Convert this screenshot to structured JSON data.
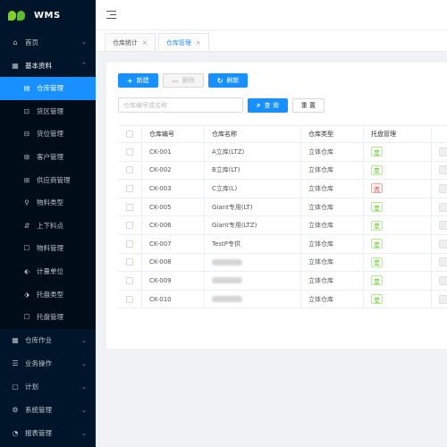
{
  "app": {
    "title": "WMS"
  },
  "sidebar": {
    "items": [
      {
        "label": "首页",
        "icon": "home-icon",
        "glyph": "⌂",
        "expanded": false
      },
      {
        "label": "基本资料",
        "icon": "grid-icon",
        "glyph": "▦",
        "expanded": true,
        "children": [
          {
            "label": "仓库管理",
            "icon": "document-icon",
            "glyph": "▤",
            "active": true
          },
          {
            "label": "货区管理",
            "icon": "area-icon",
            "glyph": "⊡"
          },
          {
            "label": "货位管理",
            "icon": "location-icon",
            "glyph": "⊟"
          },
          {
            "label": "客户管理",
            "icon": "customer-icon",
            "glyph": "⊞"
          },
          {
            "label": "供应商管理",
            "icon": "supplier-icon",
            "glyph": "⊞"
          },
          {
            "label": "物料类型",
            "icon": "material-type-icon",
            "glyph": "⚲"
          },
          {
            "label": "上下料点",
            "icon": "load-point-icon",
            "glyph": "⇵"
          },
          {
            "label": "物料管理",
            "icon": "material-icon",
            "glyph": "☐"
          },
          {
            "label": "计量单位",
            "icon": "unit-icon",
            "glyph": "⬖"
          },
          {
            "label": "托盘类型",
            "icon": "pallet-type-icon",
            "glyph": "⬗"
          },
          {
            "label": "托盘管理",
            "icon": "pallet-icon",
            "glyph": "☐"
          }
        ]
      },
      {
        "label": "仓库作业",
        "icon": "warehouse-ops-icon",
        "glyph": "▦",
        "expanded": false
      },
      {
        "label": "业务操作",
        "icon": "business-icon",
        "glyph": "☰",
        "expanded": false
      },
      {
        "label": "计划",
        "icon": "plan-icon",
        "glyph": "▢",
        "expanded": false
      },
      {
        "label": "系统管理",
        "icon": "settings-icon",
        "glyph": "⚙",
        "expanded": false
      },
      {
        "label": "报表管理",
        "icon": "report-icon",
        "glyph": "◔",
        "expanded": false
      }
    ]
  },
  "tabs": [
    {
      "label": "仓库统计",
      "active": false
    },
    {
      "label": "仓库管理",
      "active": true
    }
  ],
  "toolbar": {
    "add_label": "新建",
    "delete_label": "删除",
    "refresh_label": "刷新"
  },
  "search": {
    "placeholder": "仓库编号或名称",
    "value": "",
    "query_label": "查 询",
    "reset_label": "重 置"
  },
  "table": {
    "columns": [
      "仓库编号",
      "仓库名称",
      "仓库类型",
      "托盘管理"
    ],
    "rows": [
      {
        "code": "CK-001",
        "name": "A立库(LTZ)",
        "type": "立体仓库",
        "pallet": "是",
        "pallet_managed": true
      },
      {
        "code": "CK-002",
        "name": "B立库(LT)",
        "type": "立体仓库",
        "pallet": "是",
        "pallet_managed": true
      },
      {
        "code": "CK-003",
        "name": "C立库(L)",
        "type": "立体仓库",
        "pallet": "否",
        "pallet_managed": false
      },
      {
        "code": "CK-005",
        "name": "Giant专用(LT)",
        "type": "立体仓库",
        "pallet": "是",
        "pallet_managed": true
      },
      {
        "code": "CK-006",
        "name": "Giant专用(LTZ)",
        "type": "立体仓库",
        "pallet": "是",
        "pallet_managed": true
      },
      {
        "code": "CK-007",
        "name": "TestP专供",
        "type": "立体仓库",
        "pallet": "是",
        "pallet_managed": true
      },
      {
        "code": "CK-008",
        "name": "",
        "type": "立体仓库",
        "pallet": "是",
        "pallet_managed": true,
        "name_redacted": true
      },
      {
        "code": "CK-009",
        "name": "",
        "type": "立体仓库",
        "pallet": "是",
        "pallet_managed": true,
        "name_redacted": true
      },
      {
        "code": "CK-010",
        "name": "",
        "type": "立体仓库",
        "pallet": "是",
        "pallet_managed": true,
        "name_redacted": true
      }
    ]
  },
  "colors": {
    "sidebar_bg": "#001529",
    "accent": "#1890ff",
    "tag_yes": "#52c41a",
    "tag_no": "#f5222d"
  }
}
